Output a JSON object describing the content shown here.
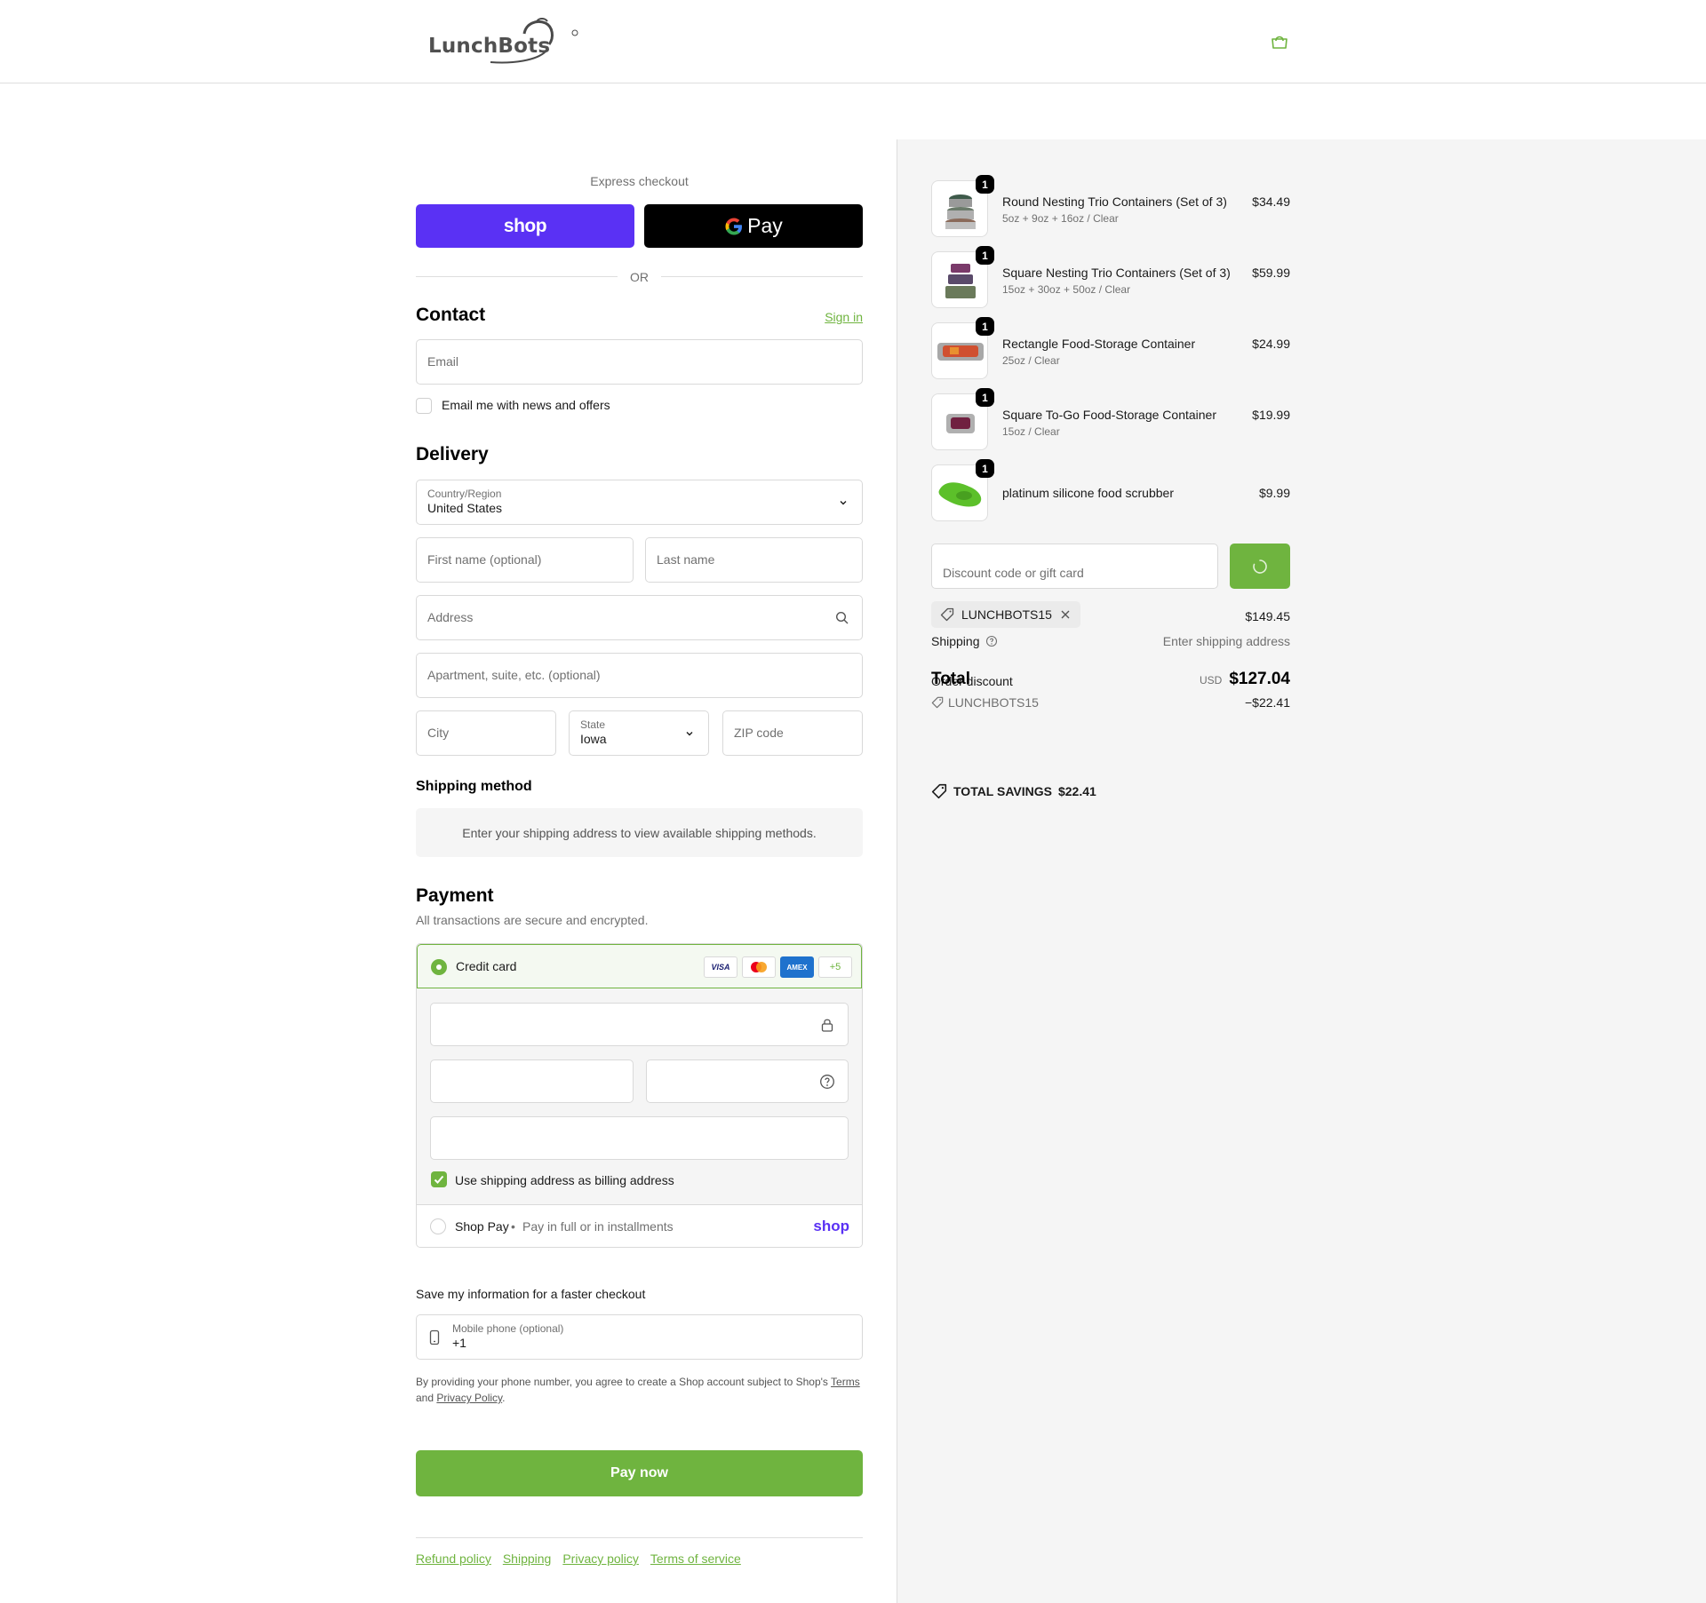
{
  "header": {
    "brand": "LunchBots",
    "cart_icon": "shopping-bag-icon"
  },
  "express": {
    "title": "Express checkout",
    "shop_label": "shop",
    "gpay_label": "Pay",
    "or_label": "OR"
  },
  "contact": {
    "heading": "Contact",
    "signin": "Sign in",
    "email_placeholder": "Email",
    "newsletter_label": "Email me with news and offers"
  },
  "delivery": {
    "heading": "Delivery",
    "country_label": "Country/Region",
    "country_value": "United States",
    "first_name_placeholder": "First name (optional)",
    "last_name_placeholder": "Last name",
    "address_placeholder": "Address",
    "apartment_placeholder": "Apartment, suite, etc. (optional)",
    "city_placeholder": "City",
    "state_label": "State",
    "state_value": "Iowa",
    "zip_placeholder": "ZIP code"
  },
  "shipping_method": {
    "heading": "Shipping method",
    "message": "Enter your shipping address to view available shipping methods."
  },
  "payment": {
    "heading": "Payment",
    "subtitle": "All transactions are secure and encrypted.",
    "credit_card_label": "Credit card",
    "card_brands": [
      "VISA",
      "Mastercard",
      "AMEX"
    ],
    "more_brands": "+5",
    "billing_label": "Use shipping address as billing address",
    "shoppay_label": "Shop Pay",
    "shoppay_sub": "Pay in full or in installments",
    "shoppay_logo": "shop"
  },
  "save_info": {
    "heading": "Save my information for a faster checkout",
    "phone_label": "Mobile phone (optional)",
    "phone_value": "+1",
    "fine_print_1": "By providing your phone number, you agree to create a Shop account subject to Shop's",
    "terms": "Terms",
    "and": "and",
    "privacy": "Privacy Policy",
    "period": "."
  },
  "pay_button": "Pay now",
  "footer_links": [
    "Refund policy",
    "Shipping",
    "Privacy policy",
    "Terms of service"
  ],
  "cart": {
    "items": [
      {
        "name": "Round Nesting Trio Containers (Set of 3)",
        "variant": "5oz + 9oz + 16oz / Clear",
        "price": "$34.49",
        "qty": "1"
      },
      {
        "name": "Square Nesting Trio Containers (Set of 3)",
        "variant": "15oz + 30oz + 50oz / Clear",
        "price": "$59.99",
        "qty": "1"
      },
      {
        "name": "Rectangle Food-Storage Container",
        "variant": "25oz / Clear",
        "price": "$24.99",
        "qty": "1"
      },
      {
        "name": "Square To-Go Food-Storage Container",
        "variant": "15oz / Clear",
        "price": "$19.99",
        "qty": "1"
      },
      {
        "name": "platinum silicone food scrubber",
        "variant": "",
        "price": "$9.99",
        "qty": "1"
      }
    ],
    "discount_placeholder": "Discount code or gift card",
    "applied_code": "LUNCHBOTS15",
    "subtotal": "$149.45",
    "shipping_label": "Shipping",
    "shipping_value": "Enter shipping address",
    "order_discount_label": "Order discount",
    "discount_code": "LUNCHBOTS15",
    "discount_amount": "−$22.41",
    "total_label": "Total",
    "currency": "USD",
    "total": "$127.04",
    "savings_label": "TOTAL SAVINGS",
    "savings_value": "$22.41"
  },
  "colors": {
    "accent": "#6fb43f",
    "shop_purple": "#5a31f4",
    "sidebar_bg": "#f5f5f5"
  }
}
